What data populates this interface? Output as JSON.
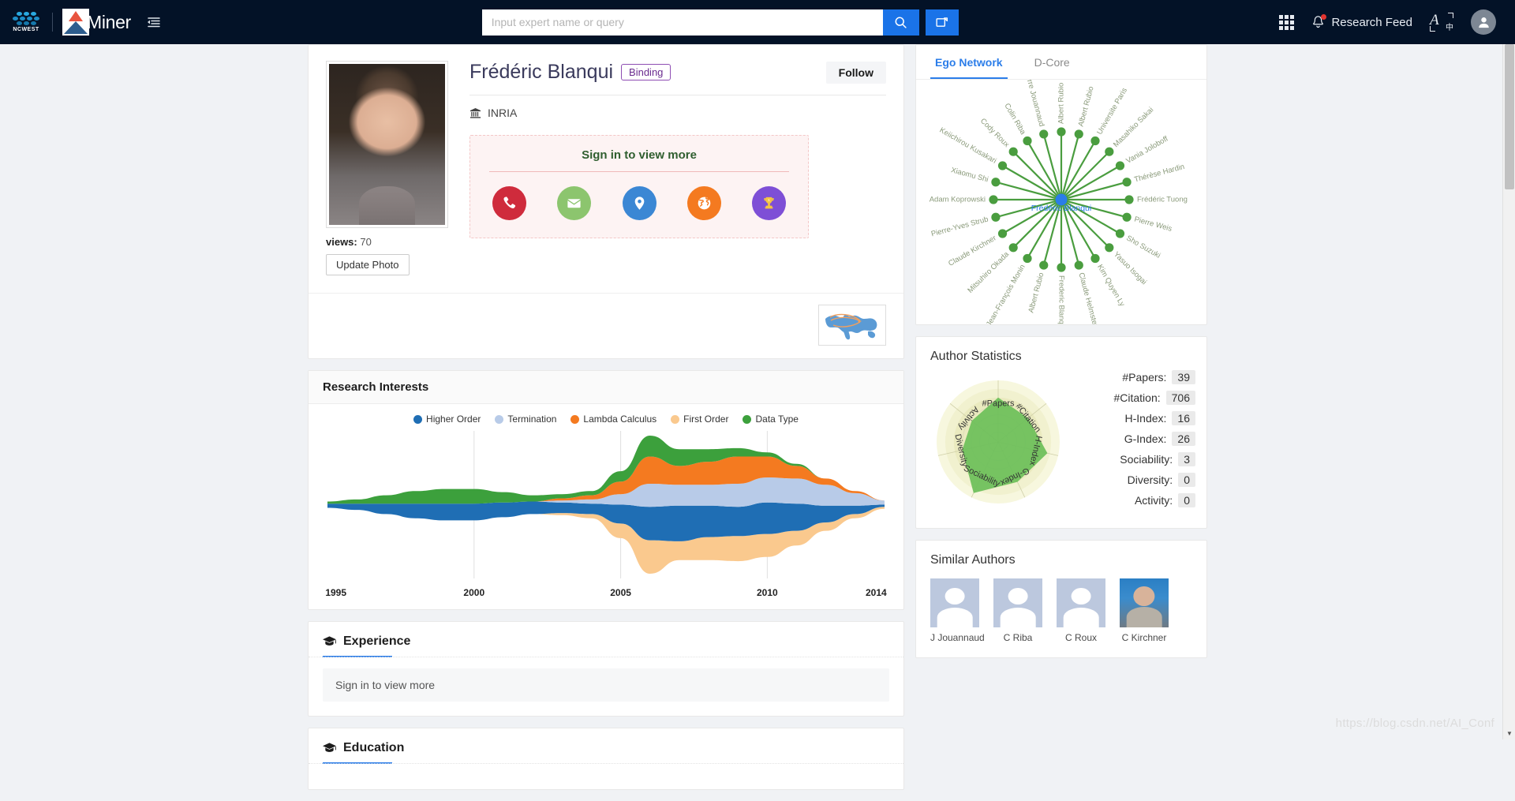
{
  "header": {
    "brand_ncwest": "NCWEST",
    "brand_aminer": "Miner",
    "menu_icon": "hamburger-list-icon",
    "search": {
      "placeholder": "Input expert name or query",
      "value": "",
      "search_icon": "search-icon",
      "extra_icon": "image-search-icon"
    },
    "apps_icon": "grid-apps-icon",
    "notifications": {
      "icon": "bell-icon",
      "label": "Research Feed",
      "has_badge": true
    },
    "language_icon": "language-translate-icon",
    "avatar_icon": "user-avatar-icon",
    "bg_color": "#031227",
    "accent_color": "#1a73e8"
  },
  "profile": {
    "photo_alt": "author-portrait",
    "views_label": "views:",
    "views_count": "70",
    "update_photo_label": "Update Photo",
    "name": "Frédéric Blanqui",
    "tag": "Binding",
    "follow_label": "Follow",
    "affiliation_icon": "institution-icon",
    "affiliation": "INRIA",
    "signin": {
      "title": "Sign in to view more",
      "icons": [
        {
          "name": "phone-icon",
          "color": "#cf2b3c"
        },
        {
          "name": "email-icon",
          "color": "#8cc56e"
        },
        {
          "name": "location-pin-icon",
          "color": "#3b87d4"
        },
        {
          "name": "globe-icon",
          "color": "#f47a20"
        },
        {
          "name": "trophy-icon",
          "color": "#7e4fd6"
        }
      ]
    },
    "map_icon": "world-map-thumbnail"
  },
  "research_interests": {
    "title": "Research Interests",
    "legend": [
      {
        "label": "Higher Order",
        "color": "#1f6eb4"
      },
      {
        "label": "Termination",
        "color": "#b8cbe8"
      },
      {
        "label": "Lambda Calculus",
        "color": "#f47a20"
      },
      {
        "label": "First Order",
        "color": "#fac98e"
      },
      {
        "label": "Data Type",
        "color": "#3ca03c"
      }
    ],
    "x_ticks": [
      "1995",
      "2000",
      "2005",
      "2010",
      "2014"
    ]
  },
  "chart_data": [
    {
      "type": "area",
      "title": "Research Interests",
      "subtitle": "",
      "xlabel": "",
      "ylabel": "",
      "xlim": [
        1995,
        2014
      ],
      "grid": true,
      "legend_position": "top-center",
      "x": [
        1995,
        1996,
        1997,
        1998,
        1999,
        2000,
        2001,
        2002,
        2003,
        2004,
        2005,
        2006,
        2007,
        2008,
        2009,
        2010,
        2011,
        2012,
        2013,
        2014
      ],
      "series": [
        {
          "name": "Higher Order",
          "color": "#1f6eb4",
          "values": [
            2,
            3,
            5,
            7,
            8,
            8,
            7,
            6,
            5,
            5,
            9,
            16,
            17,
            15,
            14,
            15,
            13,
            8,
            4,
            1
          ]
        },
        {
          "name": "Termination",
          "color": "#b8cbe8",
          "values": [
            0,
            0,
            0,
            0,
            0,
            0,
            0,
            0,
            1,
            2,
            5,
            11,
            10,
            10,
            11,
            12,
            12,
            10,
            6,
            2
          ]
        },
        {
          "name": "Lambda Calculus",
          "color": "#f47a20",
          "values": [
            0,
            0,
            0,
            0,
            0,
            0,
            0,
            0,
            1,
            2,
            6,
            13,
            9,
            11,
            13,
            10,
            6,
            3,
            1,
            0
          ]
        },
        {
          "name": "First Order",
          "color": "#fac98e",
          "values": [
            0,
            0,
            0,
            0,
            0,
            0,
            0,
            0,
            1,
            2,
            7,
            16,
            9,
            11,
            12,
            11,
            7,
            4,
            2,
            1
          ]
        },
        {
          "name": "Data Type",
          "color": "#3ca03c",
          "values": [
            1,
            2,
            4,
            6,
            7,
            7,
            5,
            3,
            2,
            2,
            5,
            10,
            8,
            6,
            4,
            2,
            1,
            0,
            0,
            0
          ]
        }
      ]
    },
    {
      "type": "radar",
      "title": "Author Statistics",
      "categories": [
        "#Papers",
        "#Citation",
        "H-Index",
        "G-Index",
        "Sociability",
        "Diversity",
        "Activity"
      ],
      "values": [
        0.72,
        0.62,
        0.82,
        0.72,
        0.92,
        0.6,
        0.55
      ],
      "fill_color": "#6bbf59",
      "ring_colors": [
        "#f5f5d6",
        "#efefc8",
        "#e8e8bb"
      ]
    }
  ],
  "experience": {
    "icon": "graduation-cap-icon",
    "title": "Experience",
    "empty_text": "Sign in to view more"
  },
  "education": {
    "icon": "graduation-cap-icon",
    "title": "Education"
  },
  "ego_network": {
    "tabs": [
      {
        "label": "Ego Network",
        "active": true
      },
      {
        "label": "D-Core",
        "active": false
      }
    ],
    "center_label": "Frédéric Blanqui",
    "center_color": "#2b7de9",
    "node_color": "#4a9d3f",
    "edge_color": "#4a9d3f",
    "nodes": [
      "Albert Rubio",
      "Albert Rubio",
      "Universite Paris",
      "Masahiko Sakai",
      "Vania Joloboff",
      "Thérèse Hardin",
      "Frédéric Tuong",
      "Pierre Weis",
      "Sho Suzuki",
      "Yasuo Isogai",
      "Kim Quyen Ly",
      "Claude Helmstetter",
      "Frederic Blanqui",
      "Albert Rubio",
      "Jean-François Monin",
      "Mitsuhiro Okada",
      "Claude Kirchner",
      "Pierre-Yves Strub",
      "Adam Koprowski",
      "Xiaomu Shi",
      "Keiichirou Kusakari",
      "Cody Roux",
      "Colin Riba",
      "Jean-Pierre Jouannaud"
    ]
  },
  "author_statistics": {
    "title": "Author Statistics",
    "rows": [
      {
        "label": "#Papers:",
        "value": "39"
      },
      {
        "label": "#Citation:",
        "value": "706"
      },
      {
        "label": "H-Index:",
        "value": "16"
      },
      {
        "label": "G-Index:",
        "value": "26"
      },
      {
        "label": "Sociability:",
        "value": "3"
      },
      {
        "label": "Diversity:",
        "value": "0"
      },
      {
        "label": "Activity:",
        "value": "0"
      }
    ],
    "radar_labels": [
      "#Papers",
      "#Citation",
      "H-Index",
      "G-Index",
      "Sociability",
      "Diversity",
      "Activity"
    ]
  },
  "similar_authors": {
    "title": "Similar Authors",
    "authors": [
      {
        "name": "J Jouannaud",
        "has_photo": false
      },
      {
        "name": "C Riba",
        "has_photo": false
      },
      {
        "name": "C Roux",
        "has_photo": false
      },
      {
        "name": "C Kirchner",
        "has_photo": true
      }
    ]
  },
  "watermark": "https://blog.csdn.net/AI_Conf"
}
